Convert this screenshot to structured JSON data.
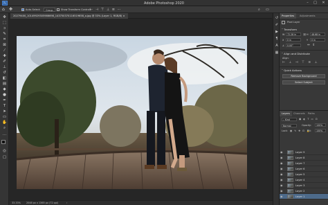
{
  "app": {
    "title": "Adobe Photoshop 2020"
  },
  "window_controls": {
    "minimize": "–",
    "maximize": "□",
    "close": "✕"
  },
  "options_bar": {
    "auto_select": "Auto-Select:",
    "group_value": "Group",
    "show_transform": "Show Transform Controls"
  },
  "document": {
    "tab_title": "20279400_10149929305986698_143750370116519658_o.jpg @ 33% (Layer 1, RGB/8)",
    "zoom": "33.33%",
    "dimensions": "2048 px x 1365 px (72 ppi)"
  },
  "right_panel": {
    "tabs": [
      "Properties",
      "Adjustments"
    ],
    "layer_kind": "Pixel Layer",
    "transform_title": "Transform",
    "transform": {
      "w": "W",
      "w_value": "72.28 in",
      "h": "H",
      "h_value": "48.68 in",
      "x": "X",
      "x_value": "0 in",
      "y": "Y",
      "y_value": "0 in",
      "angle": "0.00°"
    },
    "align_title": "Align and Distribute",
    "align_label": "Align:",
    "quick_title": "Quick Actions",
    "remove_bg": "Remove Background",
    "select_subject": "Select Subject"
  },
  "layers_panel": {
    "tabs": [
      "Layers",
      "Channels",
      "Paths"
    ],
    "kind": "Kind",
    "blend_mode": "Normal",
    "opacity_label": "Opacity:",
    "opacity_value": "100%",
    "lock_label": "Lock:",
    "fill_label": "Fill:",
    "fill_value": "100%",
    "layers": [
      "Layer 9",
      "Layer 8",
      "Layer 7",
      "Layer 6",
      "Layer 5",
      "Layer 4",
      "Layer 3",
      "Layer 2",
      "Layer 1"
    ]
  },
  "colors": {
    "selected_layer": "#4d6a8a",
    "panel": "#383838",
    "canvas_bg": "#262626"
  }
}
